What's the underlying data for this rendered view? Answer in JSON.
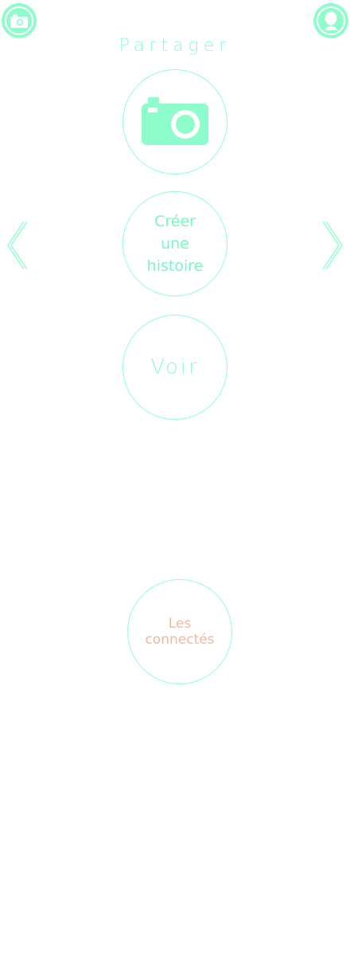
{
  "header": {
    "camera_icon": "camera-icon",
    "profile_icon": "user-icon"
  },
  "share": {
    "label": "Partager",
    "camera_icon": "camera-icon"
  },
  "create_story": {
    "label": "Créer\nune\nhistoire"
  },
  "view": {
    "label": "Voir"
  },
  "connected": {
    "label": "Les\nconnectés"
  },
  "nav": {
    "prev_icon": "chevron-left-icon",
    "next_icon": "chevron-right-icon"
  },
  "colors": {
    "accent": "#8ffccb",
    "secondary": "#f5b6a0",
    "background": "#ffffff"
  }
}
